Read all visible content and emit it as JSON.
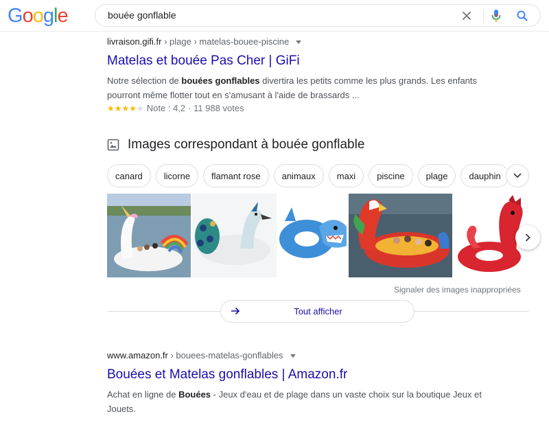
{
  "header": {
    "logo": {
      "c1": "G",
      "c2": "o",
      "c3": "o",
      "c4": "g",
      "c5": "l",
      "c6": "e"
    },
    "search_value": "bouée gonflable"
  },
  "results": [
    {
      "site": "livraison.gifi.fr",
      "path": " › plage › matelas-bouee-piscine",
      "title": "Matelas et bouée Pas Cher | GiFi",
      "snippet_pre": "Notre sélection de ",
      "snippet_bold": "bouées gonflables",
      "snippet_post": " divertira les petits comme les plus grands. Les enfants pourront même flotter tout en s'amusant à l'aide de brassards ...",
      "stars_text": "★★★★★",
      "rating": 4.2,
      "rating_text": "Note : 4,2",
      "votes_text": "· 11 988 votes"
    },
    {
      "site": "www.amazon.fr",
      "path": " › bouees-matelas-gonflables",
      "title": "Bouées et Matelas gonflables | Amazon.fr",
      "snippet_pre": "Achat en ligne de ",
      "snippet_bold": "Bouées",
      "snippet_post": " - Jeux d'eau et de plage dans un vaste choix sur la boutique Jeux et Jouets."
    }
  ],
  "images": {
    "heading": "Images correspondant à bouée gonflable",
    "chips": [
      "canard",
      "licorne",
      "flamant rose",
      "animaux",
      "maxi",
      "piscine",
      "plage",
      "dauphin"
    ],
    "thumbnails": [
      "unicorn-float",
      "peacock-float",
      "shark-ring",
      "parrot-float",
      "seahorse-float"
    ],
    "report_text": "Signaler des images inappropriées",
    "show_all": "Tout afficher"
  },
  "colors": {
    "link": "#1a0dab",
    "star": "#fbbc04",
    "mic_blue": "#4285f4",
    "mic_red": "#ea4335"
  }
}
